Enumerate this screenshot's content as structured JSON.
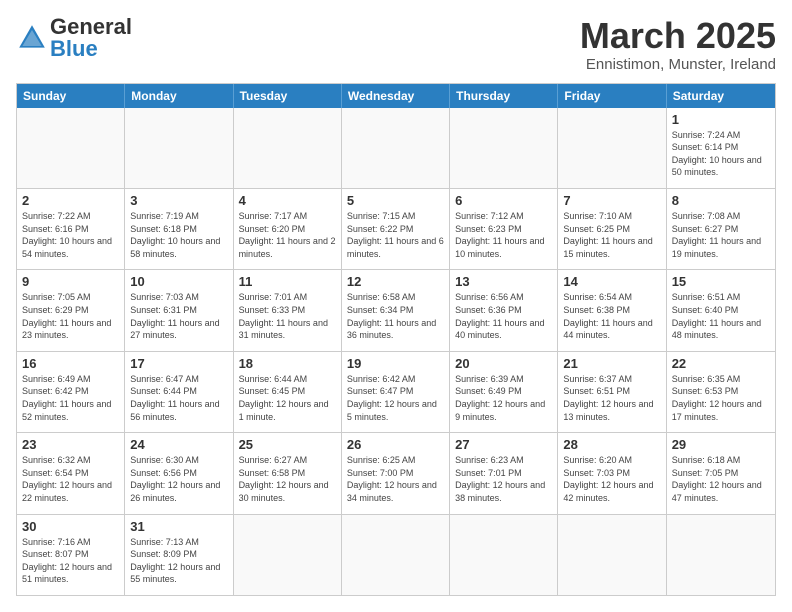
{
  "logo": {
    "general": "General",
    "blue": "Blue"
  },
  "title": "March 2025",
  "subtitle": "Ennistimon, Munster, Ireland",
  "header_days": [
    "Sunday",
    "Monday",
    "Tuesday",
    "Wednesday",
    "Thursday",
    "Friday",
    "Saturday"
  ],
  "weeks": [
    [
      {
        "day": "",
        "info": ""
      },
      {
        "day": "",
        "info": ""
      },
      {
        "day": "",
        "info": ""
      },
      {
        "day": "",
        "info": ""
      },
      {
        "day": "",
        "info": ""
      },
      {
        "day": "",
        "info": ""
      },
      {
        "day": "1",
        "info": "Sunrise: 7:24 AM\nSunset: 6:14 PM\nDaylight: 10 hours and 50 minutes."
      }
    ],
    [
      {
        "day": "2",
        "info": "Sunrise: 7:22 AM\nSunset: 6:16 PM\nDaylight: 10 hours and 54 minutes."
      },
      {
        "day": "3",
        "info": "Sunrise: 7:19 AM\nSunset: 6:18 PM\nDaylight: 10 hours and 58 minutes."
      },
      {
        "day": "4",
        "info": "Sunrise: 7:17 AM\nSunset: 6:20 PM\nDaylight: 11 hours and 2 minutes."
      },
      {
        "day": "5",
        "info": "Sunrise: 7:15 AM\nSunset: 6:22 PM\nDaylight: 11 hours and 6 minutes."
      },
      {
        "day": "6",
        "info": "Sunrise: 7:12 AM\nSunset: 6:23 PM\nDaylight: 11 hours and 10 minutes."
      },
      {
        "day": "7",
        "info": "Sunrise: 7:10 AM\nSunset: 6:25 PM\nDaylight: 11 hours and 15 minutes."
      },
      {
        "day": "8",
        "info": "Sunrise: 7:08 AM\nSunset: 6:27 PM\nDaylight: 11 hours and 19 minutes."
      }
    ],
    [
      {
        "day": "9",
        "info": "Sunrise: 7:05 AM\nSunset: 6:29 PM\nDaylight: 11 hours and 23 minutes."
      },
      {
        "day": "10",
        "info": "Sunrise: 7:03 AM\nSunset: 6:31 PM\nDaylight: 11 hours and 27 minutes."
      },
      {
        "day": "11",
        "info": "Sunrise: 7:01 AM\nSunset: 6:33 PM\nDaylight: 11 hours and 31 minutes."
      },
      {
        "day": "12",
        "info": "Sunrise: 6:58 AM\nSunset: 6:34 PM\nDaylight: 11 hours and 36 minutes."
      },
      {
        "day": "13",
        "info": "Sunrise: 6:56 AM\nSunset: 6:36 PM\nDaylight: 11 hours and 40 minutes."
      },
      {
        "day": "14",
        "info": "Sunrise: 6:54 AM\nSunset: 6:38 PM\nDaylight: 11 hours and 44 minutes."
      },
      {
        "day": "15",
        "info": "Sunrise: 6:51 AM\nSunset: 6:40 PM\nDaylight: 11 hours and 48 minutes."
      }
    ],
    [
      {
        "day": "16",
        "info": "Sunrise: 6:49 AM\nSunset: 6:42 PM\nDaylight: 11 hours and 52 minutes."
      },
      {
        "day": "17",
        "info": "Sunrise: 6:47 AM\nSunset: 6:44 PM\nDaylight: 11 hours and 56 minutes."
      },
      {
        "day": "18",
        "info": "Sunrise: 6:44 AM\nSunset: 6:45 PM\nDaylight: 12 hours and 1 minute."
      },
      {
        "day": "19",
        "info": "Sunrise: 6:42 AM\nSunset: 6:47 PM\nDaylight: 12 hours and 5 minutes."
      },
      {
        "day": "20",
        "info": "Sunrise: 6:39 AM\nSunset: 6:49 PM\nDaylight: 12 hours and 9 minutes."
      },
      {
        "day": "21",
        "info": "Sunrise: 6:37 AM\nSunset: 6:51 PM\nDaylight: 12 hours and 13 minutes."
      },
      {
        "day": "22",
        "info": "Sunrise: 6:35 AM\nSunset: 6:53 PM\nDaylight: 12 hours and 17 minutes."
      }
    ],
    [
      {
        "day": "23",
        "info": "Sunrise: 6:32 AM\nSunset: 6:54 PM\nDaylight: 12 hours and 22 minutes."
      },
      {
        "day": "24",
        "info": "Sunrise: 6:30 AM\nSunset: 6:56 PM\nDaylight: 12 hours and 26 minutes."
      },
      {
        "day": "25",
        "info": "Sunrise: 6:27 AM\nSunset: 6:58 PM\nDaylight: 12 hours and 30 minutes."
      },
      {
        "day": "26",
        "info": "Sunrise: 6:25 AM\nSunset: 7:00 PM\nDaylight: 12 hours and 34 minutes."
      },
      {
        "day": "27",
        "info": "Sunrise: 6:23 AM\nSunset: 7:01 PM\nDaylight: 12 hours and 38 minutes."
      },
      {
        "day": "28",
        "info": "Sunrise: 6:20 AM\nSunset: 7:03 PM\nDaylight: 12 hours and 42 minutes."
      },
      {
        "day": "29",
        "info": "Sunrise: 6:18 AM\nSunset: 7:05 PM\nDaylight: 12 hours and 47 minutes."
      }
    ],
    [
      {
        "day": "30",
        "info": "Sunrise: 7:16 AM\nSunset: 8:07 PM\nDaylight: 12 hours and 51 minutes."
      },
      {
        "day": "31",
        "info": "Sunrise: 7:13 AM\nSunset: 8:09 PM\nDaylight: 12 hours and 55 minutes."
      },
      {
        "day": "",
        "info": ""
      },
      {
        "day": "",
        "info": ""
      },
      {
        "day": "",
        "info": ""
      },
      {
        "day": "",
        "info": ""
      },
      {
        "day": "",
        "info": ""
      }
    ]
  ]
}
